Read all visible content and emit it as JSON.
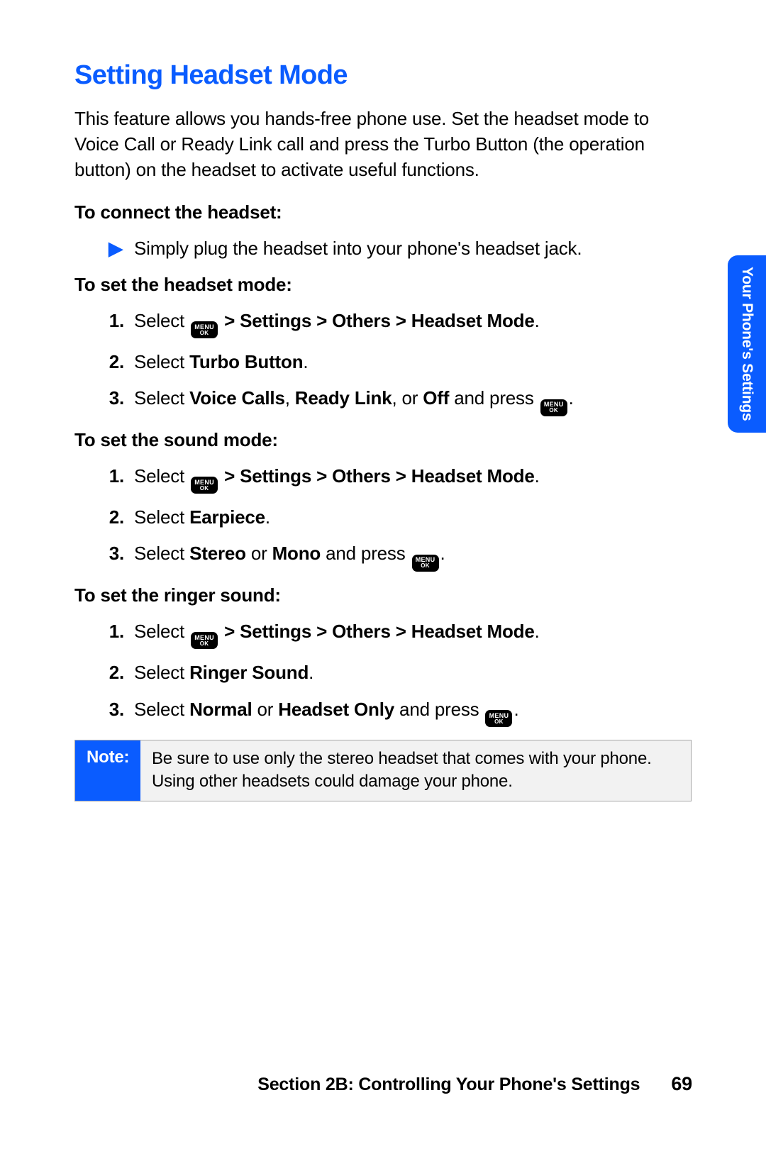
{
  "heading": "Setting Headset Mode",
  "intro": "This feature allows you hands-free phone use. Set the headset mode to Voice Call or Ready Link call and press the Turbo Button (the operation button) on the headset to activate useful functions.",
  "menu_button": {
    "top": "MENU",
    "bottom": "OK"
  },
  "arrow_glyph": "▶",
  "sections": {
    "connect": {
      "title": "To connect the headset:",
      "bullet": "Simply plug the headset into your phone's headset jack."
    },
    "headset_mode": {
      "title": "To set the headset mode:",
      "step1_prefix": "Select ",
      "step1_bold": " > Settings > Others > Headset Mode",
      "step2_prefix": "Select ",
      "step2_bold": "Turbo Button",
      "step3_prefix": "Select ",
      "step3_b1": "Voice Calls",
      "step3_sep1": ", ",
      "step3_b2": "Ready Link",
      "step3_sep2": ", or ",
      "step3_b3": "Off",
      "step3_suffix": " and press "
    },
    "sound_mode": {
      "title": "To set the sound mode:",
      "step1_prefix": "Select ",
      "step1_bold": " > Settings > Others > Headset Mode",
      "step2_prefix": "Select ",
      "step2_bold": "Earpiece",
      "step3_prefix": "Select ",
      "step3_b1": "Stereo",
      "step3_sep1": " or ",
      "step3_b2": "Mono",
      "step3_suffix": " and press "
    },
    "ringer": {
      "title": "To set the ringer sound:",
      "step1_prefix": "Select ",
      "step1_bold": " > Settings > Others > Headset Mode",
      "step2_prefix": "Select ",
      "step2_bold": "Ringer Sound",
      "step3_prefix": "Select ",
      "step3_b1": "Normal",
      "step3_sep1": " or ",
      "step3_b2": "Headset Only",
      "step3_suffix": " and press "
    }
  },
  "markers": {
    "n1": "1.",
    "n2": "2.",
    "n3": "3."
  },
  "period": ".",
  "note": {
    "label": "Note:",
    "body": "Be sure to use only the stereo headset that comes with your phone. Using other headsets could damage your phone."
  },
  "side_tab": "Your Phone's Settings",
  "footer": {
    "section": "Section 2B: Controlling Your Phone's Settings",
    "page": "69"
  }
}
